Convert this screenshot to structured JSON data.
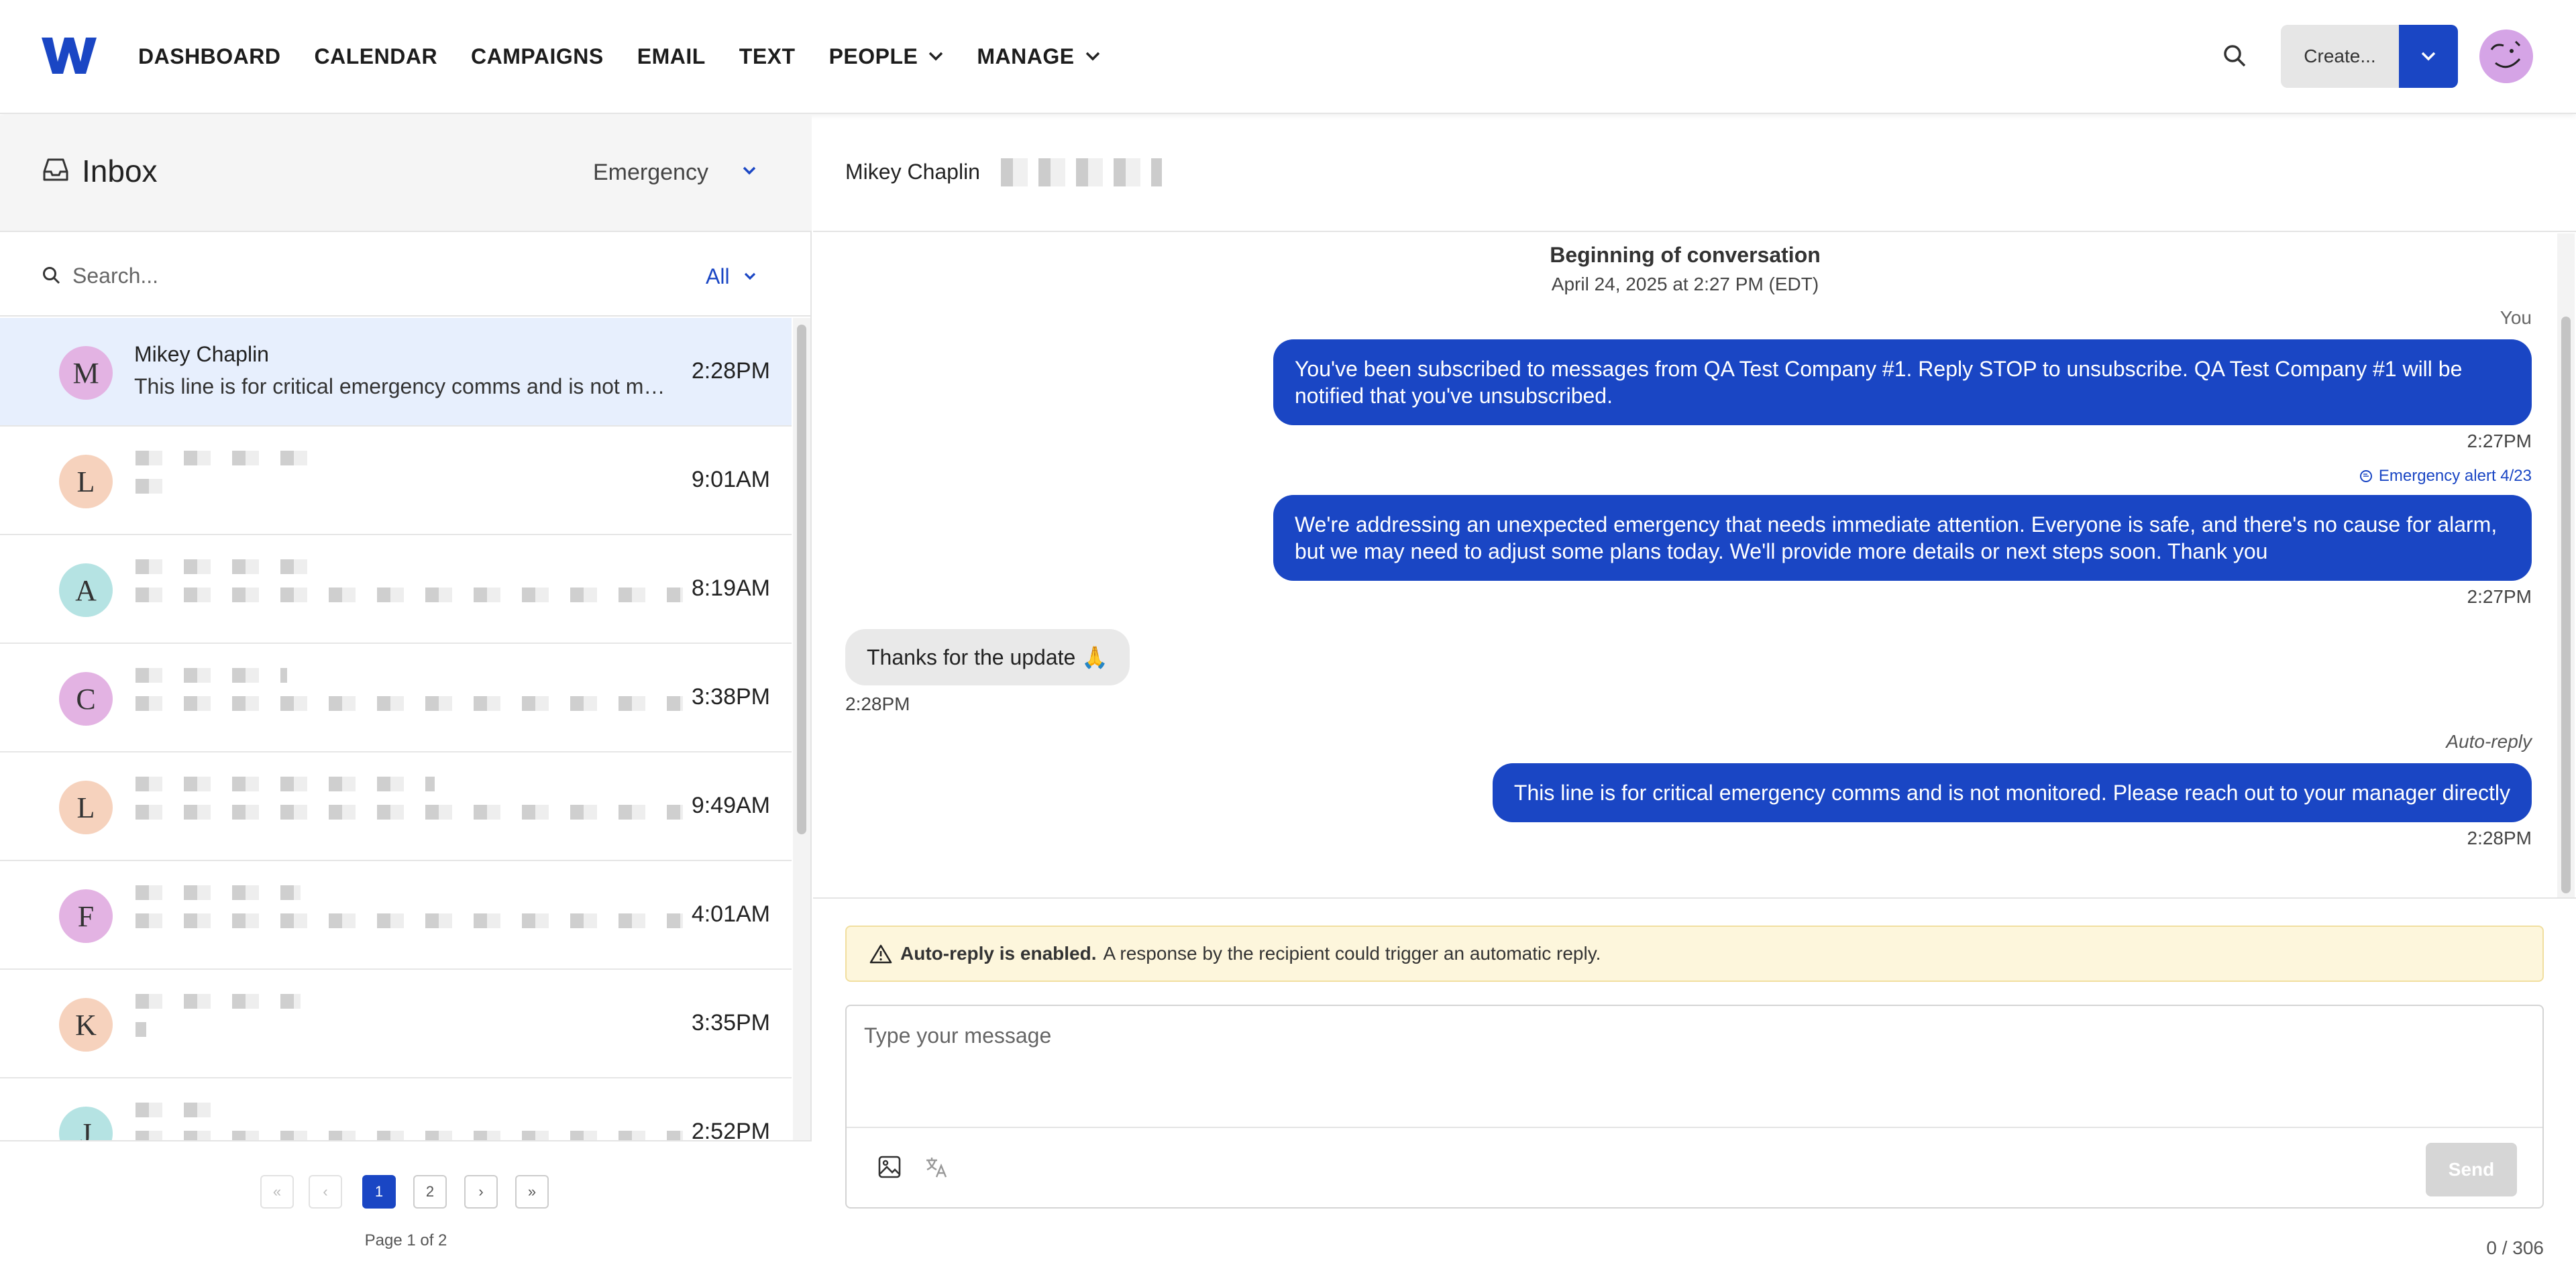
{
  "nav": {
    "logo_letter": "W",
    "links": [
      "DASHBOARD",
      "CALENDAR",
      "CAMPAIGNS",
      "EMAIL",
      "TEXT",
      "PEOPLE",
      "MANAGE"
    ],
    "create_label": "Create...",
    "brand_color": "#1a46c4"
  },
  "inbox": {
    "title": "Inbox",
    "filter": "Emergency",
    "search_placeholder": "Search...",
    "scope": "All"
  },
  "threads": [
    {
      "initial": "M",
      "name": "Mikey Chaplin",
      "preview": "This line is for critical emergency comms and is not monitored. Please reach out to your manager directly",
      "time": "2:28PM",
      "color": "#e3b3e3",
      "selected": true
    },
    {
      "initial": "L",
      "name": "",
      "preview": "",
      "time": "9:01AM",
      "color": "#f6d2bd",
      "selected": false
    },
    {
      "initial": "A",
      "name": "",
      "preview": "",
      "time": "8:19AM",
      "color": "#b5e3e3",
      "selected": false
    },
    {
      "initial": "C",
      "name": "",
      "preview": "",
      "time": "3:38PM",
      "color": "#e3b3e3",
      "selected": false
    },
    {
      "initial": "L",
      "name": "",
      "preview": "",
      "time": "9:49AM",
      "color": "#f6d2bd",
      "selected": false
    },
    {
      "initial": "F",
      "name": "",
      "preview": "",
      "time": "4:01AM",
      "color": "#e3b3e3",
      "selected": false
    },
    {
      "initial": "K",
      "name": "",
      "preview": "",
      "time": "3:35PM",
      "color": "#f6d2bd",
      "selected": false
    },
    {
      "initial": "J",
      "name": "",
      "preview": "",
      "time": "2:52PM",
      "color": "#b5e3e3",
      "selected": false
    }
  ],
  "pager": {
    "first": "«",
    "prev": "‹",
    "pages": [
      "1",
      "2"
    ],
    "next": "›",
    "last": "»",
    "info": "Page 1 of 2"
  },
  "conversation": {
    "contact_name": "Mikey Chaplin",
    "begin_title": "Beginning of conversation",
    "begin_date": "April 24, 2025 at 2:27 PM (EDT)",
    "you_label": "You",
    "msg1": "You've been subscribed to messages from QA Test Company #1. Reply STOP to unsubscribe. QA Test Company #1 will be notified that you've unsubscribed.",
    "msg1_time": "2:27PM",
    "alert_tag": "Emergency alert 4/23",
    "msg2": "We're addressing an unexpected emergency that needs immediate attention. Everyone is safe, and there's no cause for alarm, but we may need to adjust some plans today. We'll provide more details or next steps soon. Thank you",
    "msg2_time": "2:27PM",
    "reply": "Thanks for the update 🙏",
    "reply_time": "2:28PM",
    "autoreply_label": "Auto-reply",
    "msg3": "This line is for critical emergency comms and is not monitored. Please reach out to your manager directly",
    "msg3_time": "2:28PM"
  },
  "composer": {
    "warn_bold": "Auto-reply is enabled.",
    "warn_text": "A response by the recipient could trigger an automatic reply.",
    "placeholder": "Type your message",
    "send_label": "Send",
    "counter": "0 / 306"
  }
}
